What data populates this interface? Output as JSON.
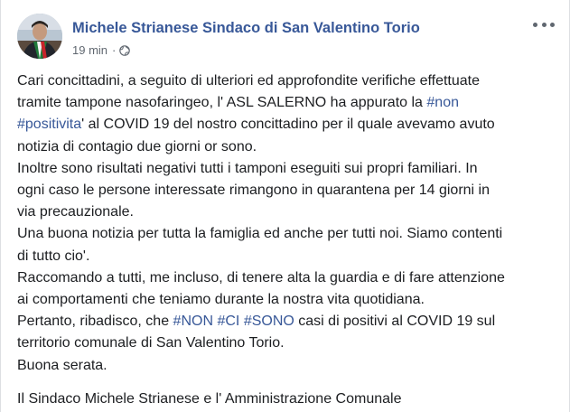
{
  "post": {
    "author": "Michele Strianese Sindaco di San Valentino Torio",
    "time": "19 min",
    "separator": "·",
    "privacy_icon": "globe-icon",
    "menu_icon": "more-options-icon",
    "avatar_icon": "profile-photo"
  },
  "body": {
    "line1": "Cari concittadini, a seguito di ulteriori ed approfondite verifiche effettuate",
    "line2_pre": "tramite tampone nasofaringeo, l' ASL SALERNO ha appurato la ",
    "hashtag_non": "#non",
    "hashtag_positivita": "#positivita",
    "line3_post": "' al COVID 19 del nostro concittadino per il quale avevamo avuto",
    "line4": "notizia di contagio due giorni or sono.",
    "line5": "Inoltre sono risultati negativi tutti i tamponi eseguiti sui propri familiari. In",
    "line6": "ogni caso le persone interessate rimangono in quarantena per 14 giorni in",
    "line7": "via precauzionale.",
    "line8": "Una buona notizia per tutta la famiglia ed anche per tutti noi. Siamo contenti",
    "line9": "di tutto cio'.",
    "line10": "Raccomando a tutti, me incluso, di tenere alta la guardia e di fare attenzione",
    "line11": "ai comportamenti che teniamo durante la nostra vita quotidiana.",
    "line12_pre": "Pertanto, ribadisco, che ",
    "hashtag_NON": "#NON",
    "hashtag_CI": "#CI",
    "hashtag_SONO": "#SONO",
    "line12_post": " casi di positivi al COVID 19 sul",
    "line13": "territorio comunale di San Valentino Torio.",
    "line14": "Buona serata.",
    "signature": "Il Sindaco Michele Strianese e l' Amministrazione Comunale"
  },
  "colors": {
    "link": "#385898",
    "text": "#1c1e21",
    "meta": "#606770",
    "background": "#ffffff"
  }
}
